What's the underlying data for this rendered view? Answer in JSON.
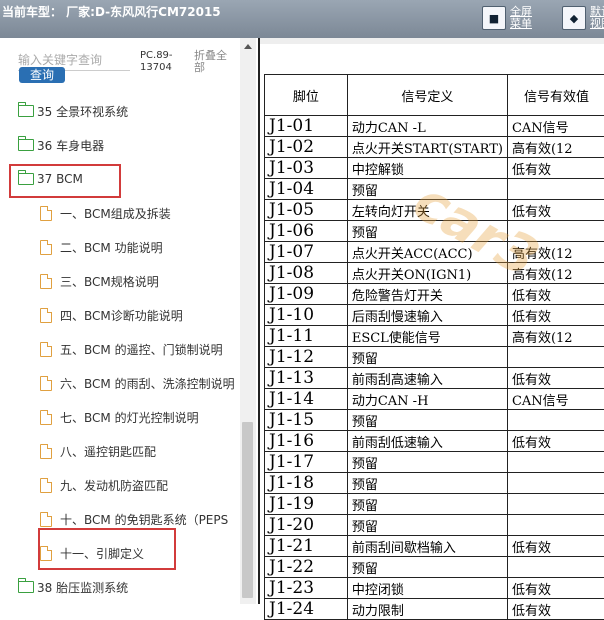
{
  "header": {
    "title": "当前车型： 厂家:D-东风风行CM72015",
    "fullscreen_label": "全屏菜单",
    "default_label": "默认视图"
  },
  "search": {
    "placeholder": "输入关键字查询",
    "button_label": "查询",
    "pc_code": "PC.89-13704",
    "collapse_all": "折叠全部"
  },
  "tree": {
    "folders": [
      {
        "label": "35 全景环视系统"
      },
      {
        "label": "36 车身电器"
      },
      {
        "label": "37 BCM"
      }
    ],
    "bcm_children": [
      "一、BCM组成及拆装",
      "二、BCM 功能说明",
      "三、BCM规格说明",
      "四、BCM诊断功能说明",
      "五、BCM 的遥控、门锁制说明",
      "六、BCM 的雨刮、洗涤控制说明",
      "七、BCM 的灯光控制说明",
      "八、遥控钥匙匹配",
      "九、发动机防盗匹配",
      "十、BCM 的免钥匙系统（PEPS",
      "十一、引脚定义"
    ],
    "last_folder": "38 胎压监测系统"
  },
  "pin_table": {
    "headers": [
      "脚位",
      "信号定义",
      "信号有效值"
    ],
    "rows": [
      [
        "J1-01",
        "动力CAN -L",
        "CAN信号"
      ],
      [
        "J1-02",
        "点火开关START(START)",
        "高有效(12"
      ],
      [
        "J1-03",
        "中控解锁",
        "低有效"
      ],
      [
        "J1-04",
        "预留",
        ""
      ],
      [
        "J1-05",
        "左转向灯开关",
        "低有效"
      ],
      [
        "J1-06",
        "预留",
        ""
      ],
      [
        "J1-07",
        "点火开关ACC(ACC)",
        "高有效(12"
      ],
      [
        "J1-08",
        "点火开关ON(IGN1)",
        "高有效(12"
      ],
      [
        "J1-09",
        "危险警告灯开关",
        "低有效"
      ],
      [
        "J1-10",
        "后雨刮慢速输入",
        "低有效"
      ],
      [
        "J1-11",
        "ESCL使能信号",
        "高有效(12"
      ],
      [
        "J1-12",
        "预留",
        ""
      ],
      [
        "J1-13",
        "前雨刮高速输入",
        "低有效"
      ],
      [
        "J1-14",
        "动力CAN -H",
        "CAN信号"
      ],
      [
        "J1-15",
        "预留",
        ""
      ],
      [
        "J1-16",
        "前雨刮低速输入",
        "低有效"
      ],
      [
        "J1-17",
        "预留",
        ""
      ],
      [
        "J1-18",
        "预留",
        ""
      ],
      [
        "J1-19",
        "预留",
        ""
      ],
      [
        "J1-20",
        "预留",
        ""
      ],
      [
        "J1-21",
        "前雨刮间歇档输入",
        "低有效"
      ],
      [
        "J1-22",
        "预留",
        ""
      ],
      [
        "J1-23",
        "中控闭锁",
        "低有效"
      ],
      [
        "J1-24",
        "动力限制",
        "低有效"
      ]
    ]
  },
  "watermark": "car3",
  "colors": {
    "highlight": "#d23b3b",
    "folder_icon": "#3aa040",
    "doc_icon": "#e0a040",
    "query_button": "#2a6fb3"
  }
}
